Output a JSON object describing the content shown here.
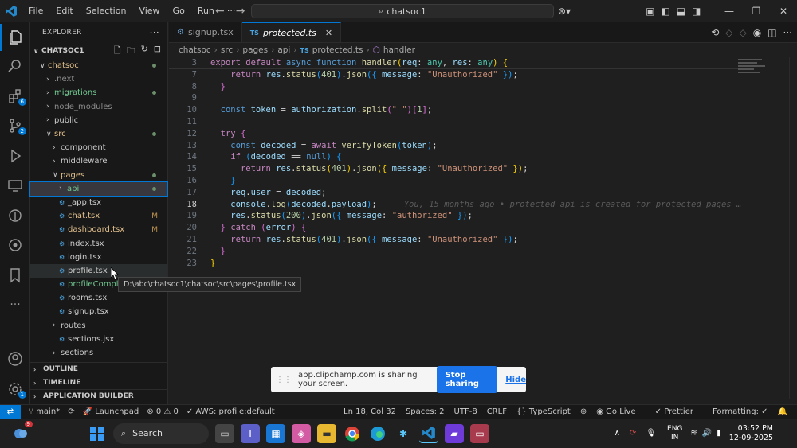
{
  "menu": [
    "File",
    "Edit",
    "Selection",
    "View",
    "Go",
    "Run",
    "···"
  ],
  "command_center": "chatsoc1",
  "explorer": {
    "title": "EXPLORER",
    "project": "CHATSOC1",
    "rows": [
      {
        "label": "chatsoc",
        "depth": 1,
        "kind": "folder-open",
        "color": "c-yellow",
        "dot": true
      },
      {
        "label": ".next",
        "depth": 2,
        "kind": "folder",
        "color": "c-grey"
      },
      {
        "label": "migrations",
        "depth": 2,
        "kind": "folder",
        "color": "c-green",
        "dot": true
      },
      {
        "label": "node_modules",
        "depth": 2,
        "kind": "folder",
        "color": "c-grey"
      },
      {
        "label": "public",
        "depth": 2,
        "kind": "folder",
        "color": "c-white"
      },
      {
        "label": "src",
        "depth": 2,
        "kind": "folder-open",
        "color": "c-yellow",
        "dot": true
      },
      {
        "label": "component",
        "depth": 3,
        "kind": "folder",
        "color": "c-white"
      },
      {
        "label": "middleware",
        "depth": 3,
        "kind": "folder",
        "color": "c-white"
      },
      {
        "label": "pages",
        "depth": 3,
        "kind": "folder-open",
        "color": "c-yellow",
        "dot": true
      },
      {
        "label": "api",
        "depth": 4,
        "kind": "folder",
        "color": "c-green",
        "dot": true,
        "selected": true
      },
      {
        "label": "_app.tsx",
        "depth": 4,
        "kind": "file",
        "color": "c-white"
      },
      {
        "label": "chat.tsx",
        "depth": 4,
        "kind": "file",
        "color": "c-yellow",
        "mark": "M"
      },
      {
        "label": "dashboard.tsx",
        "depth": 4,
        "kind": "file",
        "color": "c-yellow",
        "mark": "M"
      },
      {
        "label": "index.tsx",
        "depth": 4,
        "kind": "file",
        "color": "c-white"
      },
      {
        "label": "login.tsx",
        "depth": 4,
        "kind": "file",
        "color": "c-white"
      },
      {
        "label": "profile.tsx",
        "depth": 4,
        "kind": "file",
        "color": "c-white",
        "hover": true
      },
      {
        "label": "profileComple",
        "depth": 4,
        "kind": "file",
        "color": "c-green"
      },
      {
        "label": "rooms.tsx",
        "depth": 4,
        "kind": "file",
        "color": "c-white"
      },
      {
        "label": "signup.tsx",
        "depth": 4,
        "kind": "file",
        "color": "c-white"
      },
      {
        "label": "routes",
        "depth": 3,
        "kind": "folder",
        "color": "c-white"
      },
      {
        "label": "sections.jsx",
        "depth": 4,
        "kind": "file",
        "color": "c-white"
      },
      {
        "label": "sections",
        "depth": 3,
        "kind": "folder",
        "color": "c-white"
      }
    ],
    "sections": [
      "OUTLINE",
      "TIMELINE",
      "APPLICATION BUILDER"
    ]
  },
  "tabs": [
    {
      "label": "signup.tsx",
      "active": false
    },
    {
      "label": "protected.ts",
      "active": true
    }
  ],
  "breadcrumb": [
    "chatsoc",
    "src",
    "pages",
    "api",
    "protected.ts",
    "handler"
  ],
  "tooltip": "D:\\abc\\chatsoc1\\chatsoc\\src\\pages\\profile.tsx",
  "blame": "You, 15 months ago • protected api is created for protected pages …",
  "line_numbers": [
    "3",
    "7",
    "8",
    "9",
    "10",
    "11",
    "12",
    "13",
    "14",
    "15",
    "16",
    "17",
    "18",
    "19",
    "20",
    "21",
    "22",
    "23"
  ],
  "share_bar": {
    "text": "app.clipchamp.com is sharing your screen.",
    "stop": "Stop sharing",
    "hide": "Hide"
  },
  "status": {
    "branch": "main*",
    "launchpad": "Launchpad",
    "problems": "⊗ 0 ⚠ 0",
    "aws": "AWS: profile:default",
    "cursor": "Ln 18, Col 32",
    "spaces": "Spaces: 2",
    "encoding": "UTF-8",
    "eol": "CRLF",
    "language": "{} TypeScript",
    "golive": "Go Live",
    "prettier": "Prettier",
    "formatting": "Formatting: ✓"
  },
  "taskbar": {
    "search": "Search",
    "lang1": "ENG",
    "lang2": "IN",
    "time": "03:52 PM",
    "date": "12-09-2025",
    "weather_badge": "9"
  }
}
